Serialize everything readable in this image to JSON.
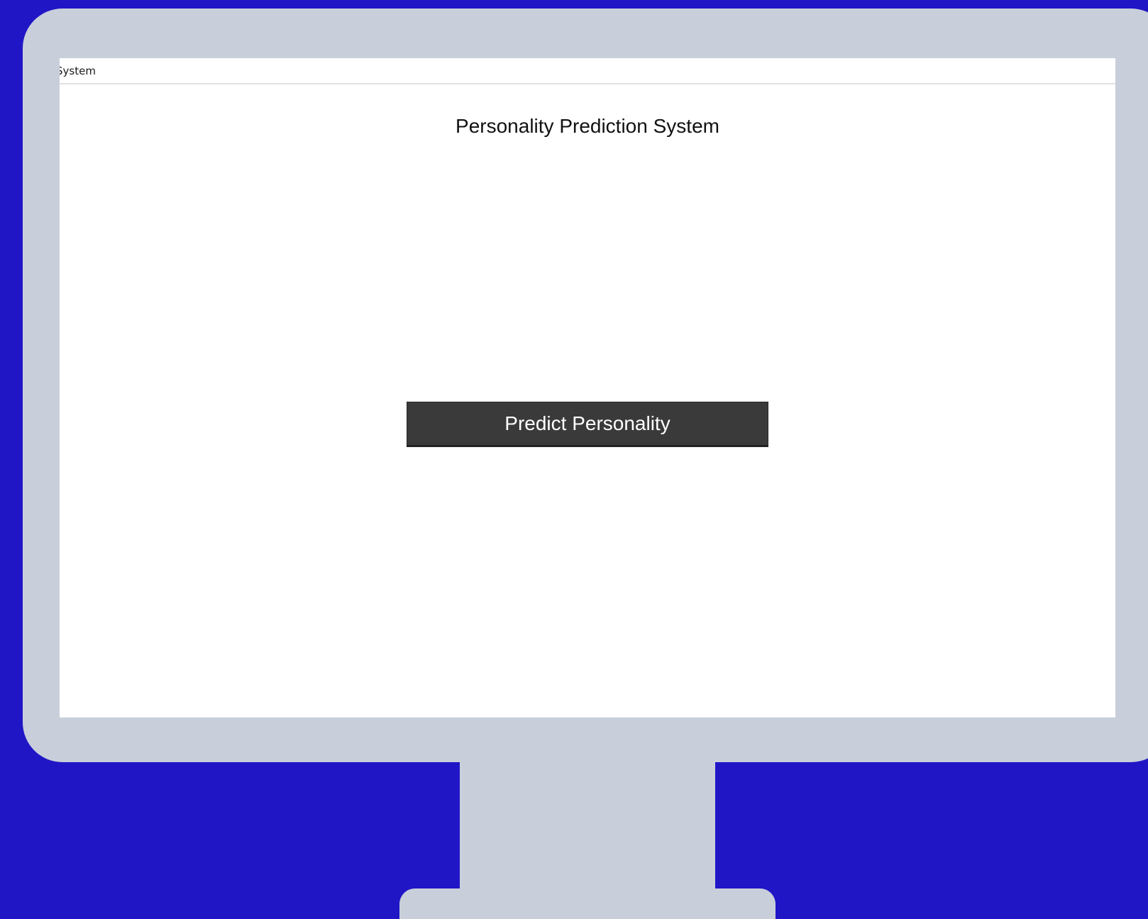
{
  "window": {
    "title": "System"
  },
  "app": {
    "heading": "Personality Prediction System",
    "predict_button_label": "Predict Personality"
  },
  "colors": {
    "background": "#2016c6",
    "monitor": "#c8cfda",
    "screen": "#ffffff",
    "button": "#3a3a3a",
    "button_text": "#ffffff"
  }
}
